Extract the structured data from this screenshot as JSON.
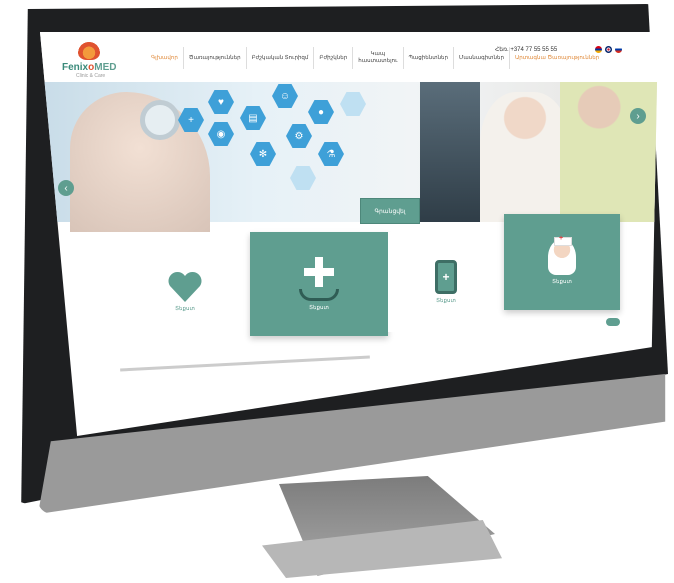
{
  "header": {
    "logo_text_a": "Fenix",
    "logo_text_b": "o",
    "logo_text_c": "MED",
    "logo_sub": "Clinic & Care",
    "nav": [
      {
        "label": "Գլխավոր"
      },
      {
        "label": "Ծառայություններ"
      },
      {
        "label": "Բժշկական Տուրիզմ"
      },
      {
        "label": "Բժիշկներ"
      },
      {
        "label": "Կապ\nհաստատելու"
      },
      {
        "label": "Պացիենտներ"
      },
      {
        "label": "Մասնագիտներ"
      },
      {
        "label": "Արտագնա Ծառայություններ"
      }
    ],
    "phone": "Հեռ. +374 77 55 55 55",
    "colors": {
      "accent": "#5f9e90",
      "nav_active": "#e08a3a"
    }
  },
  "hero": {
    "button_label": "Գրանցվել",
    "prev_icon": "chevron-left-icon",
    "next_icon": "chevron-right-icon",
    "prev": "‹",
    "next": "›"
  },
  "services": [
    {
      "label": "Տեքստ",
      "icon": "heart-icon"
    },
    {
      "label": "Տեքստ",
      "icon": "medical-cross-icon"
    },
    {
      "label": "Տեքստ",
      "icon": "mobile-health-icon"
    },
    {
      "label": "Տեքստ",
      "icon": "nurse-icon"
    }
  ]
}
